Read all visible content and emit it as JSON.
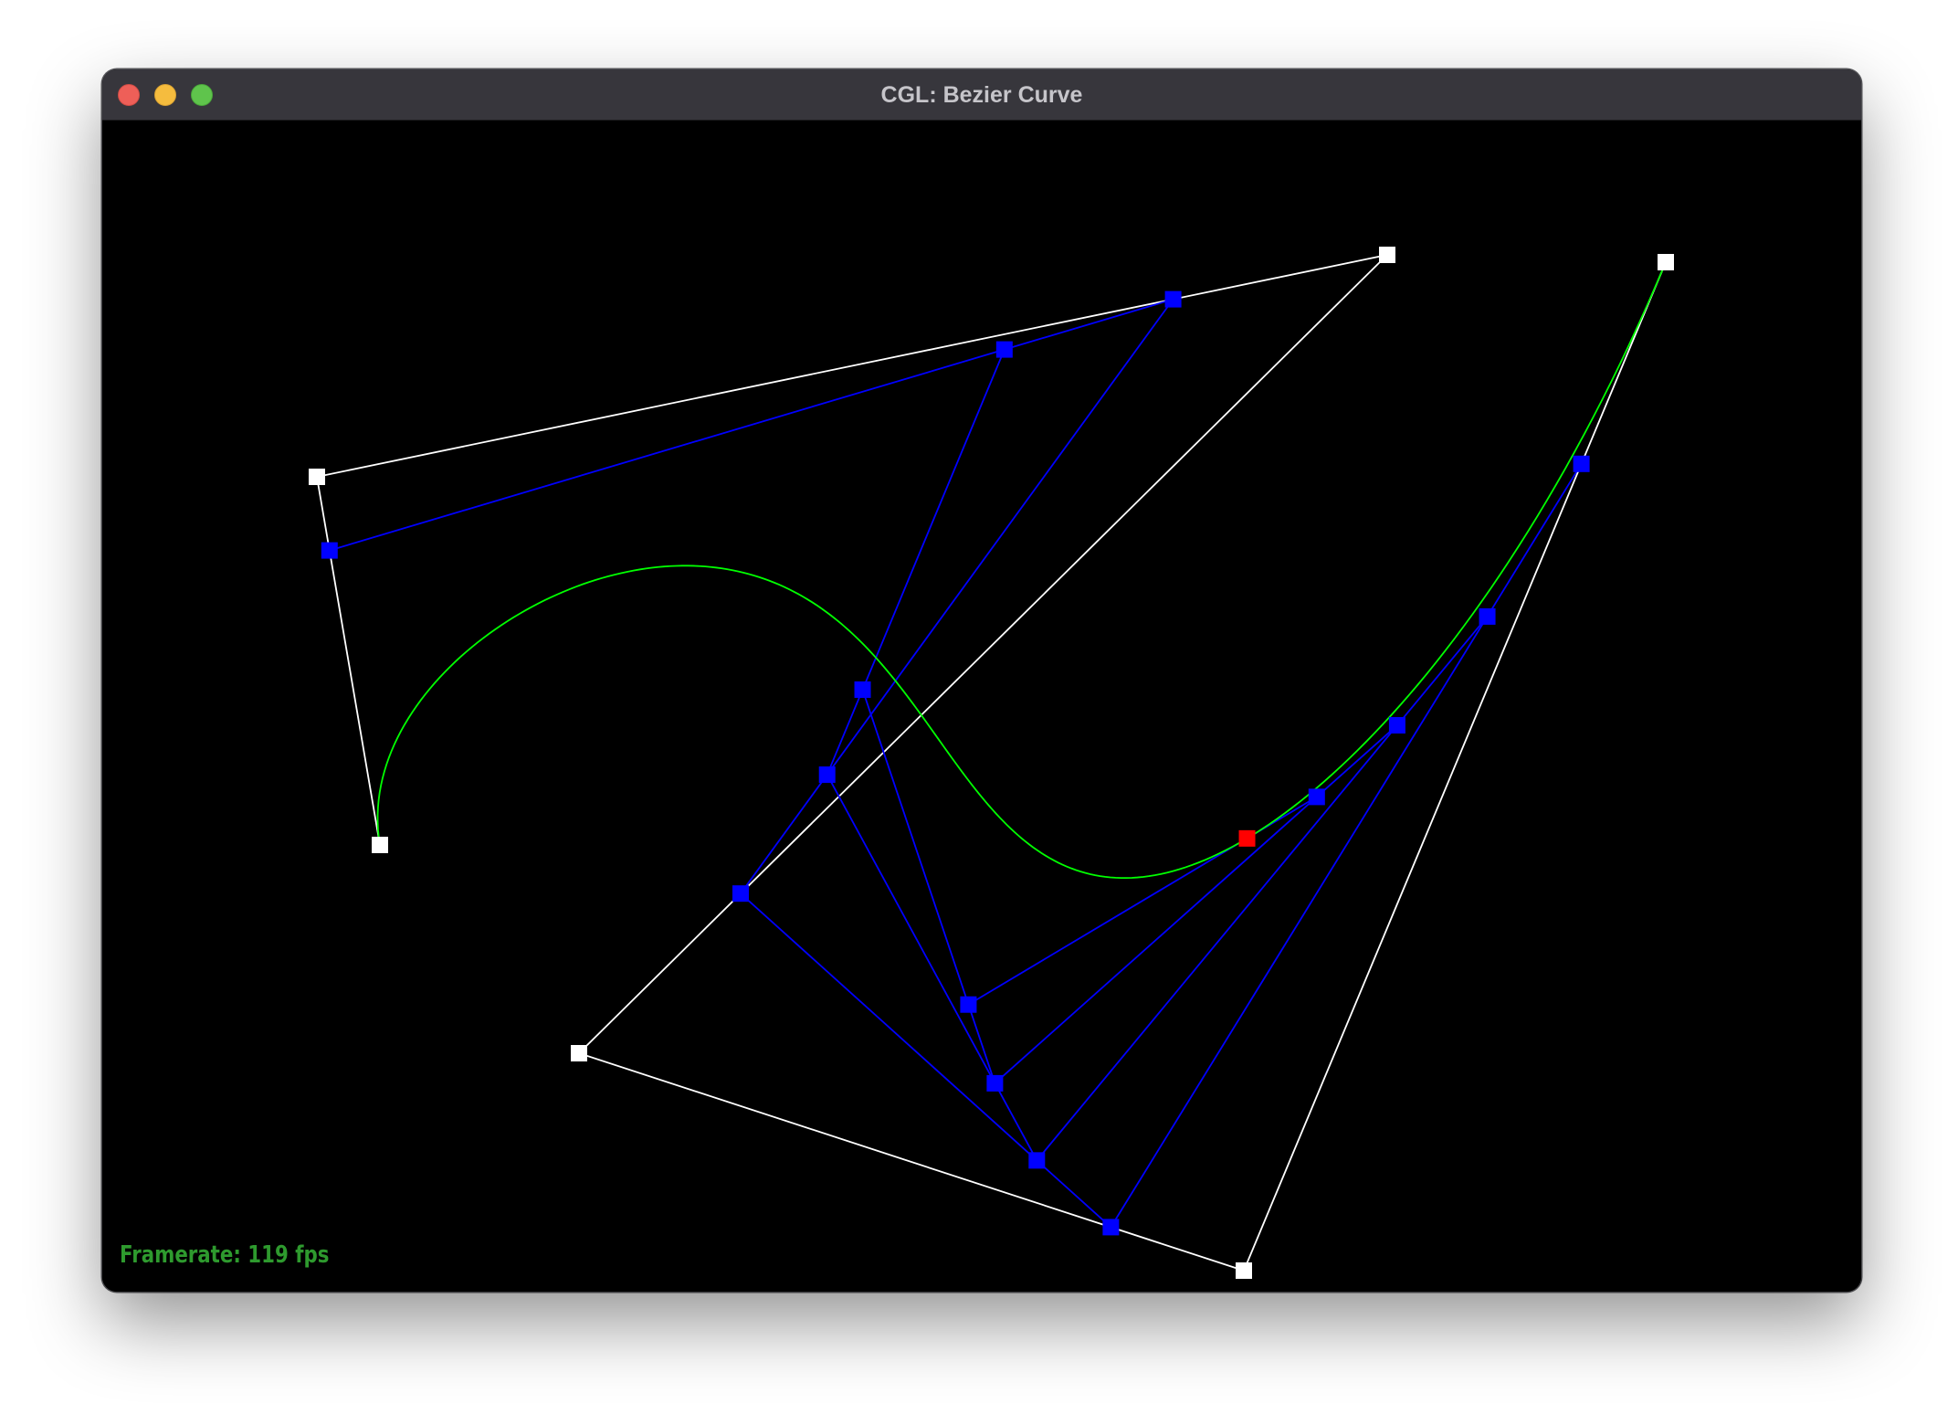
{
  "window": {
    "title": "CGL: Bezier Curve"
  },
  "status": {
    "framerate_label": "Framerate:",
    "framerate_value": "119",
    "framerate_unit": "fps"
  },
  "colors": {
    "control_polygon": "#ffffff",
    "intermediate_levels": "#0000ff",
    "curve": "#00ff00",
    "evaluated_point": "#ff0000",
    "framerate_text": "#2e9a2e"
  }
}
